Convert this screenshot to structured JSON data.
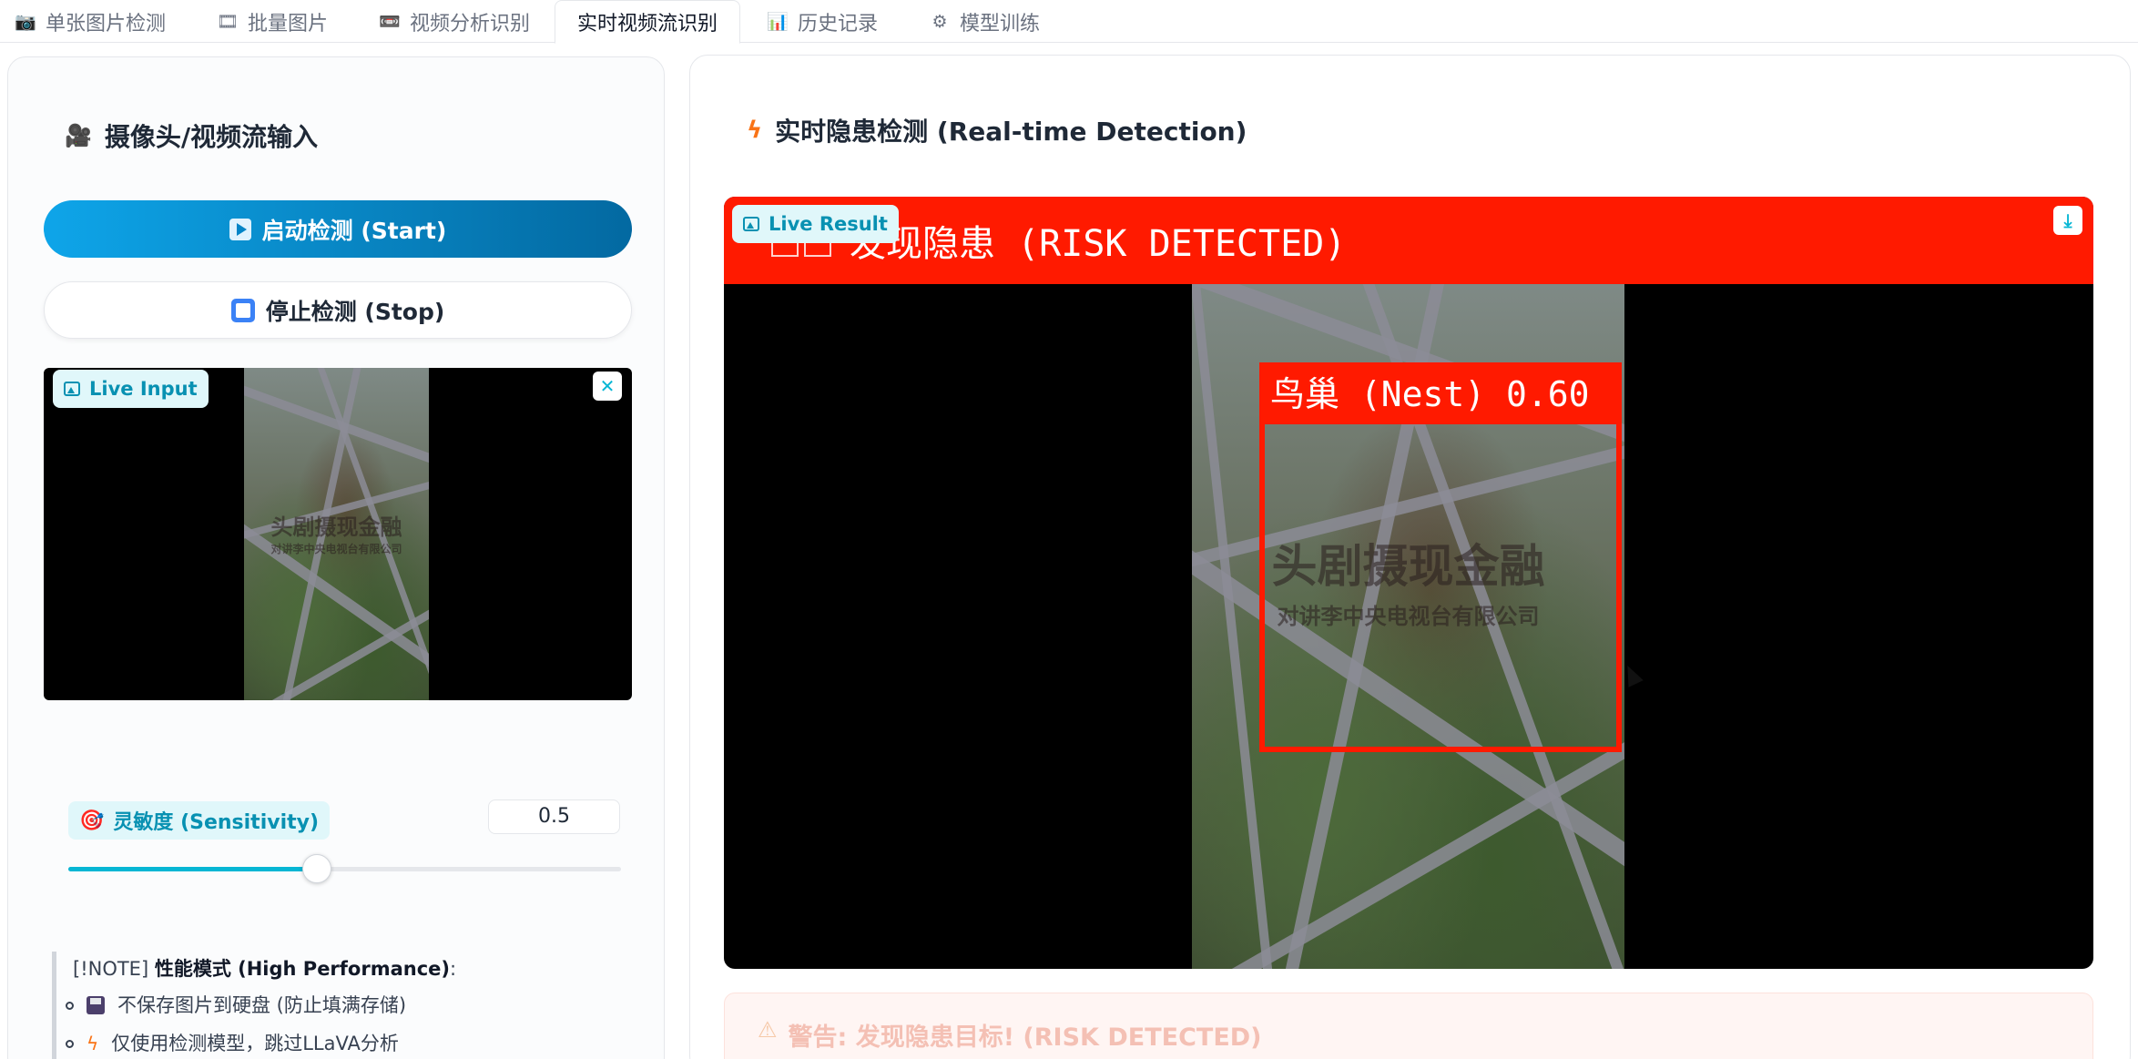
{
  "tabs": [
    {
      "label": "单张图片检测",
      "icon": "camera-icon"
    },
    {
      "label": "批量图片",
      "icon": "film-frames-icon"
    },
    {
      "label": "视频分析识别",
      "icon": "videocassette-icon"
    },
    {
      "label": "实时视频流识别",
      "icon": "",
      "active": true
    },
    {
      "label": "历史记录",
      "icon": "bar-chart-icon"
    },
    {
      "label": "模型训练",
      "icon": "gear-icon"
    }
  ],
  "left": {
    "title": "摄像头/视频流输入",
    "start_label": "启动检测 (Start)",
    "stop_label": "停止检测 (Stop)",
    "live_input_label": "Live Input",
    "video_watermark_main": "头剧摄现金融",
    "video_watermark_sub": "对讲李中央电视台有限公司"
  },
  "sensitivity": {
    "label": "灵敏度 (Sensitivity)",
    "value": "0.5",
    "min": 0,
    "max": 1,
    "fraction": 0.45
  },
  "note": {
    "prefix": "[!NOTE] ",
    "title": "性能模式 (High Performance)",
    "suffix": ":",
    "items": [
      {
        "icon": "floppy-disk-icon",
        "text": "不保存图片到硬盘 (防止填满存储)"
      },
      {
        "icon": "lightning-icon",
        "text": "仅使用检测模型，跳过LLaVA分析"
      }
    ]
  },
  "right": {
    "title": "实时隐患检测 (Real-time Detection)",
    "live_result_label": "Live Result",
    "risk_banner": "发现隐患 (RISK DETECTED)",
    "detection_label": "鸟巢 (Nest) 0.60",
    "detection_confidence": 0.6,
    "video_watermark_main": "头剧摄现金融",
    "video_watermark_sub": "对讲李中央电视台有限公司",
    "warning": "警告: 发现隐患目标! (RISK DETECTED)"
  },
  "colors": {
    "accent": "#0ea5e9",
    "badge_text": "#0891b2",
    "risk_red": "#ff1a00"
  }
}
